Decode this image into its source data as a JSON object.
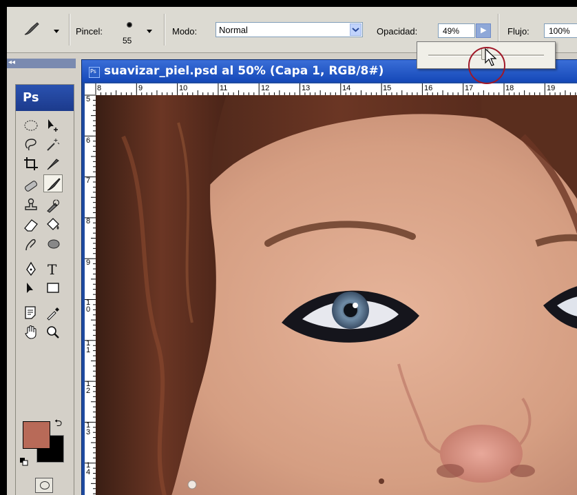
{
  "options_bar": {
    "brush_label": "Pincel:",
    "brush_size": "55",
    "mode_label": "Modo:",
    "mode_value": "Normal",
    "opacity_label": "Opacidad:",
    "opacity_value": "49%",
    "flow_label": "Flujo:",
    "flow_value": "100%"
  },
  "opacity_slider": {
    "level": 0.49
  },
  "document": {
    "title": "suavizar_piel.psd al 50% (Capa 1, RGB/8#)",
    "icon_text": "Ps",
    "ruler_h": [
      "9",
      "10",
      "11",
      "12",
      "13",
      "14",
      "15",
      "16",
      "17",
      "18",
      "19"
    ],
    "ruler_h_start": "8",
    "ruler_v": [
      "5",
      "6",
      "7",
      "8",
      "9",
      "10",
      "11",
      "12",
      "13",
      "14"
    ]
  },
  "toolbox": {
    "logo": "Ps",
    "collapse_glyph": "◂◂",
    "foreground_color": "#b86a58",
    "background_color": "#000000"
  }
}
